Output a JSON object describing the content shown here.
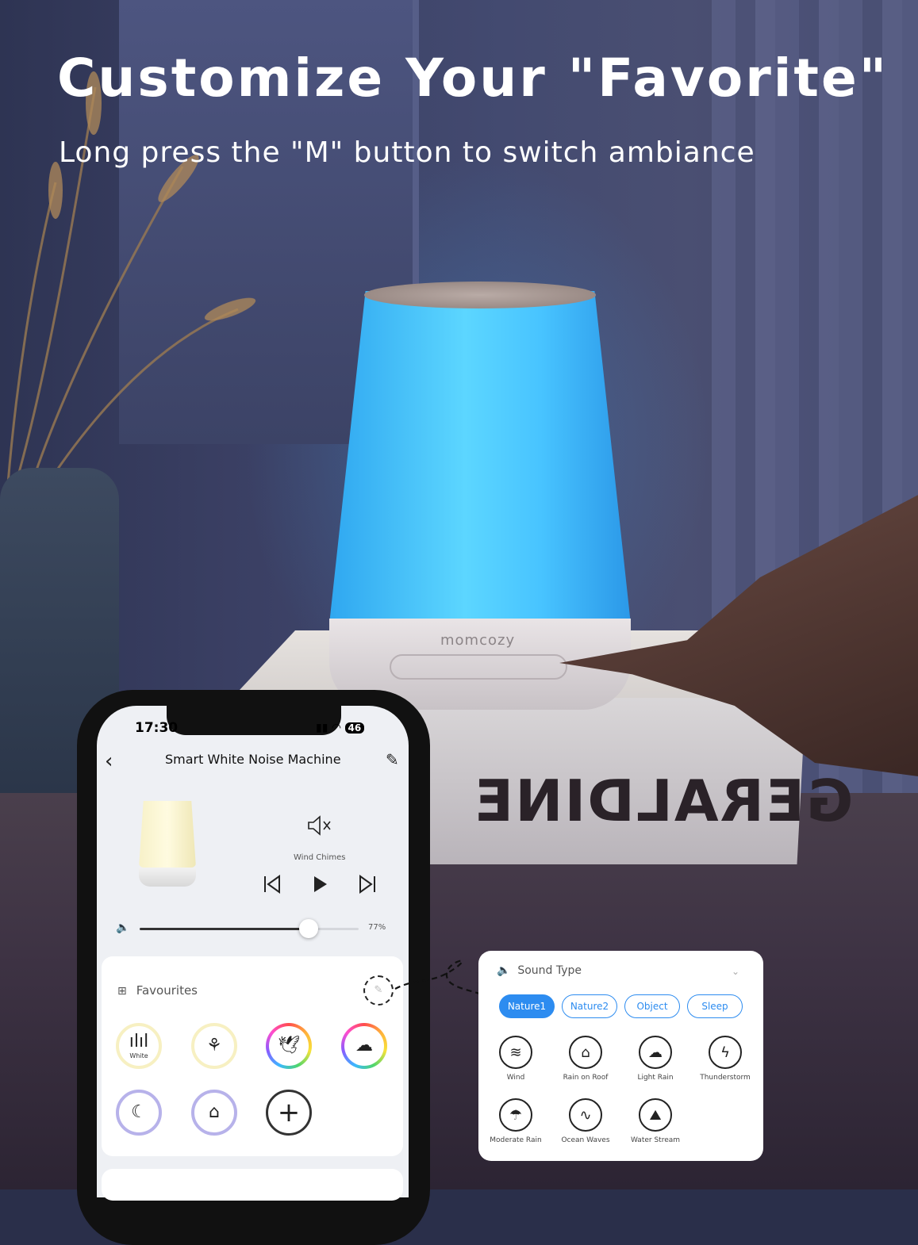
{
  "headline": "Customize Your \"Favorite\"",
  "subline": "Long press the \"M\" button to switch ambiance",
  "lamp": {
    "brand": "momcozy",
    "light_color": "#4fc9ff"
  },
  "book": {
    "title": "GERALDINE"
  },
  "phone": {
    "status_time": "17:30",
    "status_badge": "46",
    "app_title": "Smart White Noise Machine",
    "now_playing": "Wind Chimes",
    "volume_percent": 77,
    "volume_text": "77%",
    "favourites_title": "Favourites",
    "favourites": [
      {
        "icon": "white-noise-icon",
        "label": "White"
      },
      {
        "icon": "cricket-icon"
      },
      {
        "icon": "bird-icon"
      },
      {
        "icon": "rain-cloud-icon"
      },
      {
        "icon": "moon-sleep-icon"
      },
      {
        "icon": "rain-on-roof-icon"
      },
      {
        "icon": "add-icon"
      }
    ]
  },
  "sound_type": {
    "title": "Sound Type",
    "tabs": [
      "Nature1",
      "Nature2",
      "Object",
      "Sleep"
    ],
    "active_tab": "Nature1",
    "accent": "#2d8cf0",
    "sounds": [
      {
        "label": "Wind",
        "icon": "wind-icon"
      },
      {
        "label": "Rain on Roof",
        "icon": "rain-on-roof-icon"
      },
      {
        "label": "Light Rain",
        "icon": "light-rain-icon"
      },
      {
        "label": "Thunderstorm",
        "icon": "thunderstorm-icon"
      },
      {
        "label": "Moderate Rain",
        "icon": "moderate-rain-icon"
      },
      {
        "label": "Ocean Waves",
        "icon": "ocean-waves-icon"
      },
      {
        "label": "Water Stream",
        "icon": "water-stream-icon"
      }
    ]
  }
}
